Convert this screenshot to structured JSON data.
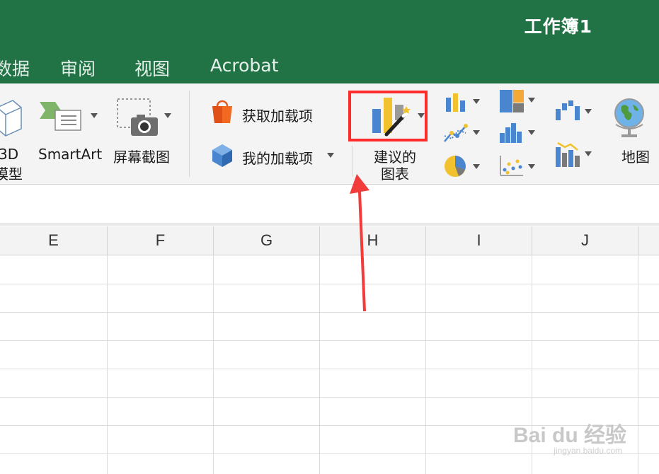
{
  "window": {
    "title": "工作簿1"
  },
  "tabs": [
    {
      "label": "数据"
    },
    {
      "label": "审阅"
    },
    {
      "label": "视图"
    },
    {
      "label": "Acrobat"
    }
  ],
  "ribbon": {
    "model3d_label_line1": "3D",
    "model3d_label_line2": "模型",
    "smartart_label": "SmartArt",
    "screenshot_label": "屏幕截图",
    "get_addins_label": "获取加载项",
    "my_addins_label": "我的加载项",
    "recommended_charts_line1": "建议的",
    "recommended_charts_line2": "图表",
    "maps_label": "地图"
  },
  "columns": [
    "E",
    "F",
    "G",
    "H",
    "I",
    "J"
  ],
  "watermark": {
    "brand": "Bai du 经验",
    "url": "jingyan.baidu.com"
  },
  "colors": {
    "excel_green": "#217346",
    "highlight_red": "#ff2b2b"
  }
}
